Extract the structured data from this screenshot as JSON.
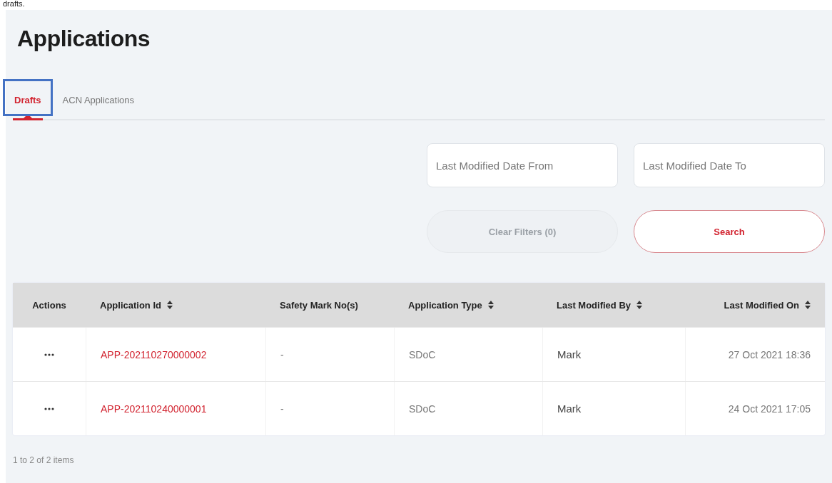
{
  "top_caption": "drafts.",
  "page": {
    "title": "Applications"
  },
  "tabs": [
    {
      "label": "Drafts",
      "selected": true,
      "highlighted": true
    },
    {
      "label": "ACN Applications",
      "selected": false,
      "highlighted": false
    }
  ],
  "filters": {
    "fields": [
      {
        "placeholder": "Last Modified Date From"
      },
      {
        "placeholder": "Last Modified Date To"
      }
    ],
    "buttons": [
      {
        "label": "Clear Filters (0)",
        "disabled": true
      },
      {
        "label": "Search",
        "disabled": false
      }
    ]
  },
  "table": {
    "columns": [
      {
        "label": "Actions",
        "sortable": false
      },
      {
        "label": "Application Id",
        "sortable": true
      },
      {
        "label": "Safety Mark No(s)",
        "sortable": false
      },
      {
        "label": "Application Type",
        "sortable": true
      },
      {
        "label": "Last Modified By",
        "sortable": true
      },
      {
        "label": "Last Modified On",
        "sortable": true
      }
    ],
    "rows": [
      {
        "application_id": "APP-202110270000002",
        "safety_mark_nos": "-",
        "application_type": "SDoC",
        "last_modified_by": "Mark",
        "last_modified_on": "27 Oct 2021 18:36"
      },
      {
        "application_id": "APP-202110240000001",
        "safety_mark_nos": "-",
        "application_type": "SDoC",
        "last_modified_by": "Mark",
        "last_modified_on": "24 Oct 2021 17:05"
      }
    ]
  },
  "pagination": {
    "summary": "1 to 2 of 2 items"
  }
}
